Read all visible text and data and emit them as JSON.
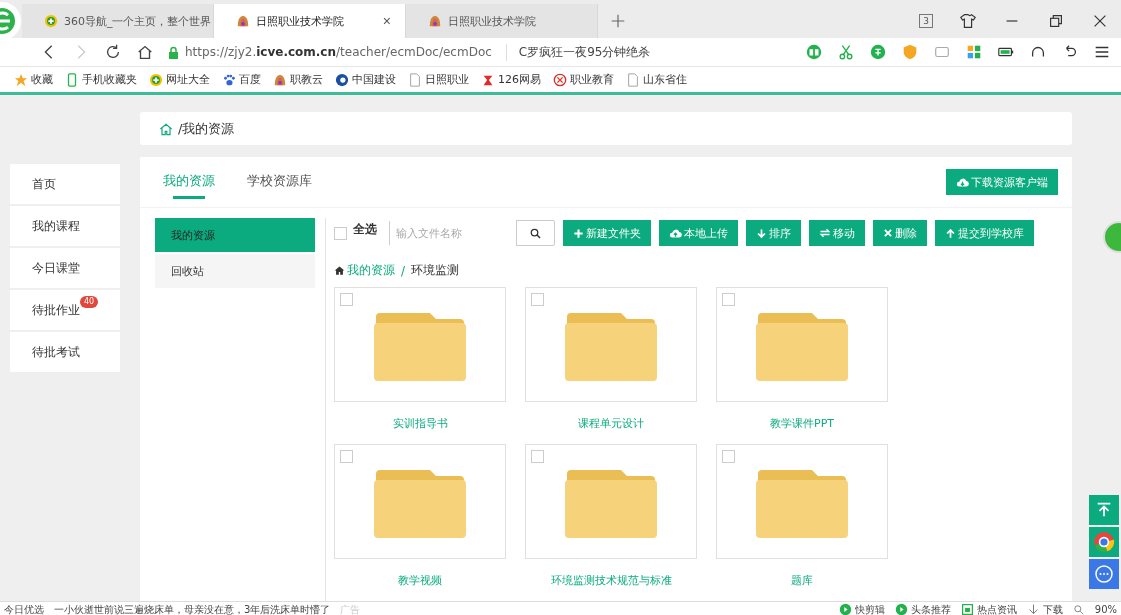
{
  "browser": {
    "tabs": [
      {
        "label": "360导航_一个主页，整个世界",
        "kind": "globe",
        "selected": false
      },
      {
        "label": "日照职业技术学院",
        "kind": "shell",
        "selected": true,
        "close": "×"
      },
      {
        "label": "日照职业技术学院",
        "kind": "shell",
        "selected": false
      }
    ],
    "tab_count": "3",
    "url": "https://zjy2.**icve.com.cn**/teacher/ecmDoc/ecmDoc",
    "search_value": "C罗疯狂一夜95分钟绝杀",
    "bookmarks": [
      {
        "label": "收藏",
        "kind": "star"
      },
      {
        "label": "手机收藏夹",
        "kind": "phone"
      },
      {
        "label": "网址大全",
        "kind": "globe"
      },
      {
        "label": "百度",
        "kind": "paw"
      },
      {
        "label": "职教云",
        "kind": "shell"
      },
      {
        "label": "中国建设",
        "kind": "bank"
      },
      {
        "label": "日照职业",
        "kind": "page"
      },
      {
        "label": "126网易",
        "kind": "mail"
      },
      {
        "label": "职业教育",
        "kind": "edu"
      },
      {
        "label": "山东省住",
        "kind": "page"
      }
    ]
  },
  "breadcrumb": {
    "current": "/我的资源"
  },
  "sidebar": {
    "items": [
      {
        "label": "首页",
        "selected": false
      },
      {
        "label": "我的课程",
        "selected": false
      },
      {
        "label": "今日课堂",
        "selected": false
      },
      {
        "label": "待批作业",
        "selected": false,
        "badge": "40"
      },
      {
        "label": "待批考试",
        "selected": false
      }
    ]
  },
  "tabs": [
    {
      "label": "我的资源",
      "selected": true
    },
    {
      "label": "学校资源库",
      "selected": false
    }
  ],
  "download_button": "下载资源客户端",
  "subnav": [
    {
      "label": "我的资源",
      "selected": true
    },
    {
      "label": "回收站",
      "selected": false
    }
  ],
  "toolbar": {
    "select_all": {
      "label": "全选",
      "checked": false
    },
    "search": {
      "placeholder": "输入文件名称"
    },
    "buttons": [
      {
        "label": "新建文件夹",
        "kind": "plus"
      },
      {
        "label": "本地上传",
        "kind": "cloud-up"
      },
      {
        "label": "排序",
        "kind": "down"
      },
      {
        "label": "移动",
        "kind": "swap"
      },
      {
        "label": "删除",
        "kind": "x"
      },
      {
        "label": "提交到学校库",
        "kind": "up"
      }
    ]
  },
  "path": {
    "root": "我的资源",
    "separator": "/",
    "current": "环境监测"
  },
  "folders": [
    {
      "name": "实训指导书",
      "checked": false
    },
    {
      "name": "课程单元设计",
      "checked": false
    },
    {
      "name": "教学课件PPT",
      "checked": false
    },
    {
      "name": "教学视频",
      "checked": false
    },
    {
      "name": "环境监测技术规范与标准",
      "checked": false
    },
    {
      "name": "题库",
      "checked": false
    }
  ],
  "status_bar": {
    "label": "今日优选",
    "news": "一小伙逝世前说三遍烧床单，母亲没在意，3年后洗床单时懵了",
    "ad": "广告",
    "items": [
      {
        "label": "快剪辑",
        "kind": "play"
      },
      {
        "label": "头条推荐",
        "kind": "play"
      },
      {
        "label": "热点资讯",
        "kind": "news"
      },
      {
        "label": "下载",
        "kind": "download"
      }
    ],
    "zoom": "90%"
  }
}
